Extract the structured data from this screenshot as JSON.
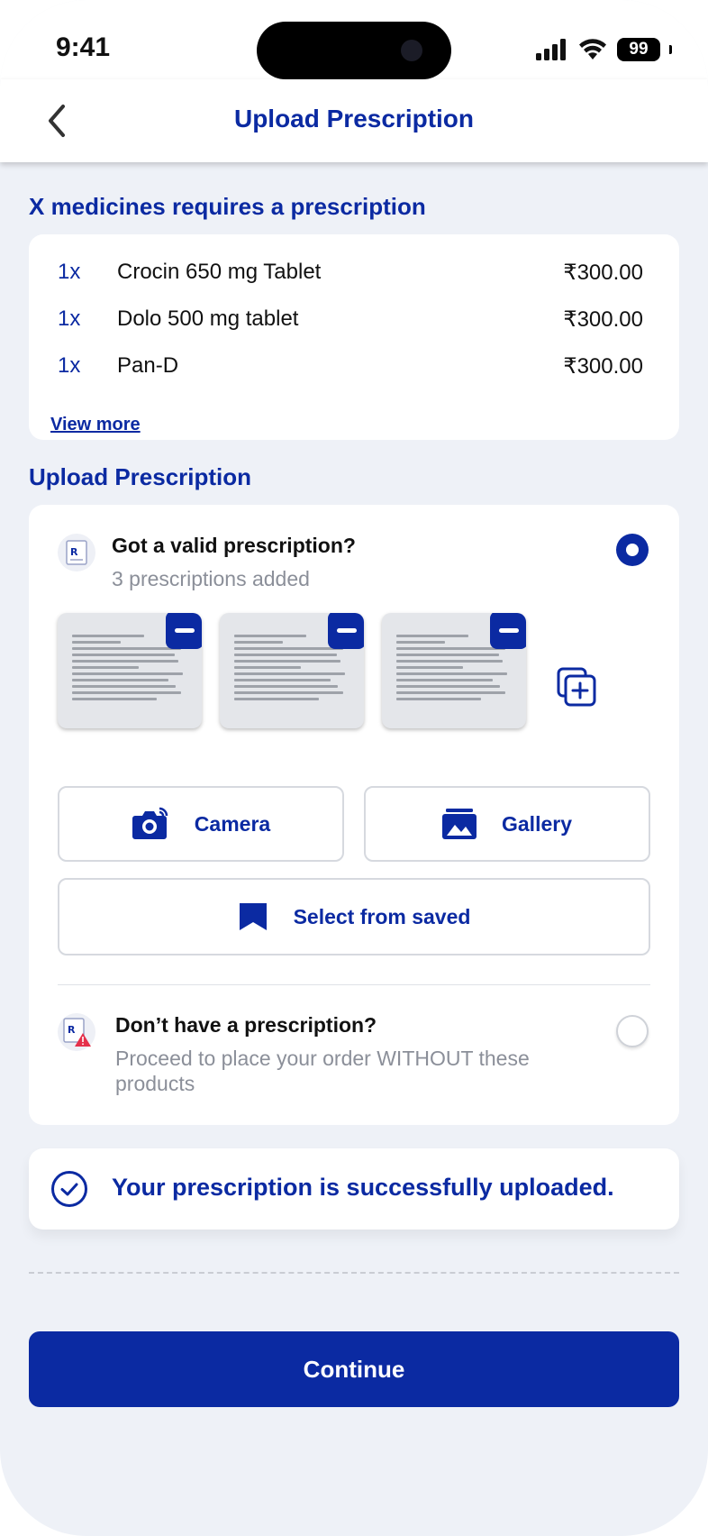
{
  "status_bar": {
    "time": "9:41",
    "battery": "99"
  },
  "header": {
    "title": "Upload Prescription"
  },
  "medicines_section": {
    "title": "X medicines requires a prescription",
    "items": [
      {
        "qty": "1x",
        "name": "Crocin 650 mg Tablet",
        "price": "₹300.00"
      },
      {
        "qty": "1x",
        "name": "Dolo 500 mg tablet",
        "price": "₹300.00"
      },
      {
        "qty": "1x",
        "name": "Pan-D",
        "price": "₹300.00"
      }
    ],
    "view_more": "View more"
  },
  "upload_section": {
    "title": "Upload Prescription",
    "valid_option": {
      "title": "Got a valid prescription?",
      "subtitle": "3 prescriptions added",
      "selected": true
    },
    "prescriptions": [
      {
        "name": "prescription-1"
      },
      {
        "name": "prescription-2"
      },
      {
        "name": "prescription-3"
      }
    ],
    "buttons": {
      "camera": "Camera",
      "gallery": "Gallery",
      "saved": "Select from saved"
    },
    "no_prescription_option": {
      "title": "Don’t have a prescription?",
      "subtitle": "Proceed to place your order WITHOUT these products",
      "selected": false
    }
  },
  "success_message": "Your prescription is successfully uploaded.",
  "continue_label": "Continue",
  "colors": {
    "primary": "#0b2aa2",
    "background": "#eef1f7",
    "muted": "#8b8f99",
    "alert": "#e5304a"
  }
}
